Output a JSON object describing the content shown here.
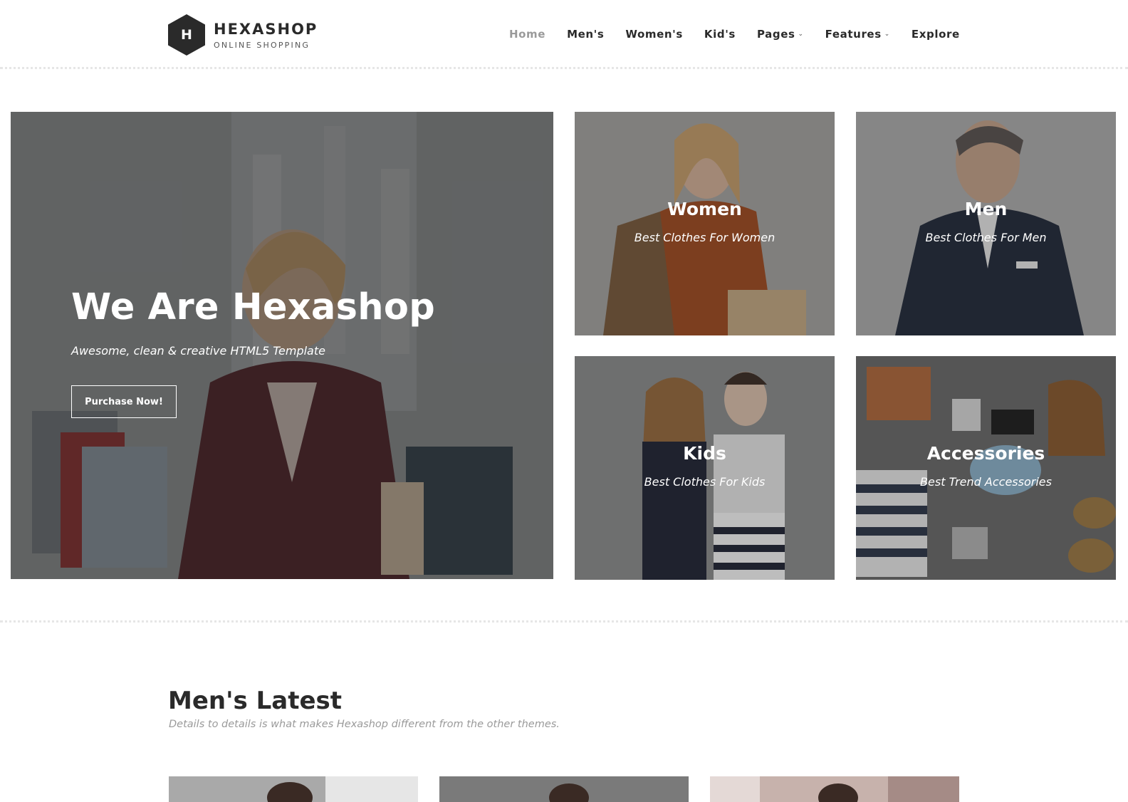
{
  "brand": {
    "logo_letter": "H",
    "name": "HEXASHOP",
    "tagline": "ONLINE SHOPPING"
  },
  "nav": {
    "items": [
      {
        "label": "Home",
        "active": true
      },
      {
        "label": "Men's"
      },
      {
        "label": "Women's"
      },
      {
        "label": "Kid's"
      },
      {
        "label": "Pages",
        "has_dropdown": true
      },
      {
        "label": "Features",
        "has_dropdown": true
      },
      {
        "label": "Explore"
      }
    ]
  },
  "hero": {
    "title": "We Are Hexashop",
    "subtitle": "Awesome, clean & creative HTML5 Template",
    "button_label": "Purchase Now!"
  },
  "categories": [
    {
      "title": "Women",
      "subtitle": "Best Clothes For Women"
    },
    {
      "title": "Men",
      "subtitle": "Best Clothes For Men"
    },
    {
      "title": "Kids",
      "subtitle": "Best Clothes For Kids"
    },
    {
      "title": "Accessories",
      "subtitle": "Best Trend Accessories"
    }
  ],
  "mens_latest": {
    "title": "Men's Latest",
    "subtitle": "Details to details is what makes Hexashop different from the other themes."
  },
  "colors": {
    "text_dark": "#2a2a2a",
    "nav_active": "#9a9a9a",
    "overlay": "#262626"
  },
  "icons": {
    "dropdown": "chevron-down-icon",
    "logo": "hexagon-logo-icon"
  }
}
